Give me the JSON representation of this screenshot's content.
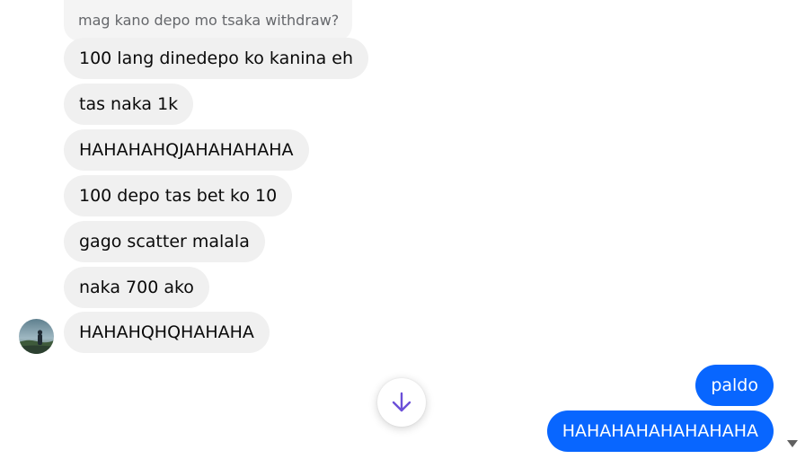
{
  "conversation": {
    "reply_preview": "mag kano depo mo tsaka withdraw?",
    "incoming": [
      "100 lang dinedepo ko kanina eh",
      "tas naka 1k",
      "HAHAHAHQJAHAHAHAHA",
      "100 depo tas bet ko 10",
      "gago scatter malala",
      "naka 700 ako",
      "HAHAHQHQHAHAHA"
    ],
    "outgoing": [
      "paldo",
      "HAHAHAHAHAHAHAHA"
    ]
  },
  "icons": {
    "avatar": "contact-avatar-photo",
    "scroll_down": "arrow-down-icon",
    "scrollbar": "scroll-down-arrow"
  },
  "colors": {
    "outgoing_bubble": "#0866ff",
    "incoming_bubble": "#f0f0f0",
    "scroll_arrow": "#6b4fd8"
  }
}
